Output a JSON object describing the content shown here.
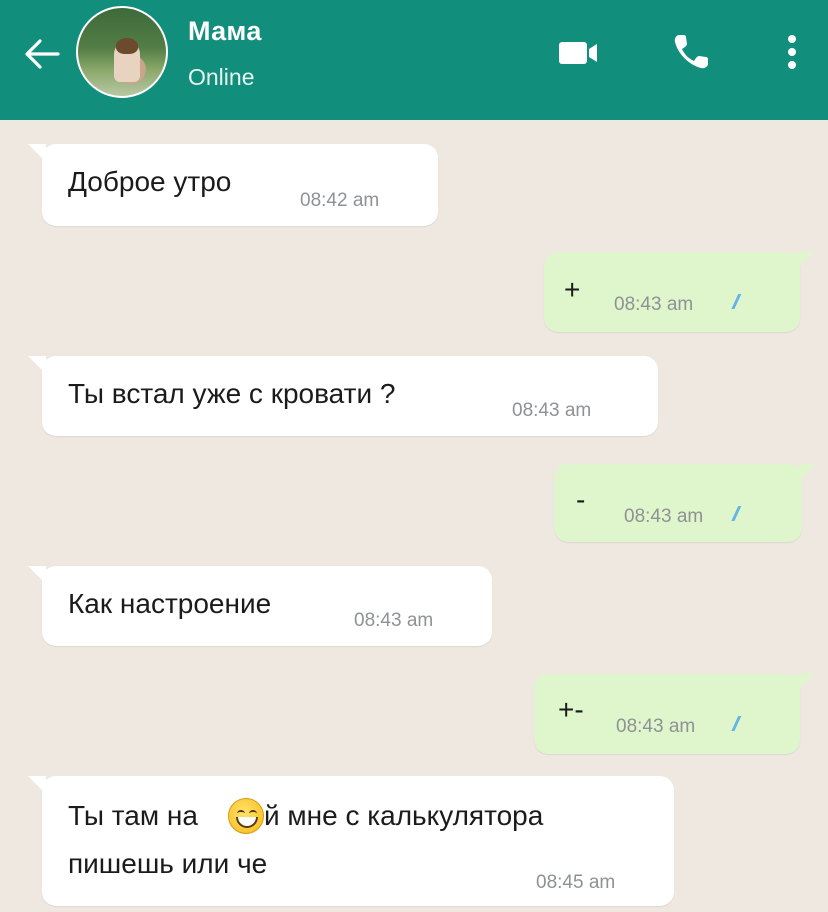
{
  "header": {
    "contact_name": "Мама",
    "status": "Online",
    "icons": [
      "back-arrow-icon",
      "video-camera-icon",
      "phone-icon",
      "more-vertical-icon"
    ],
    "bg_color": "#128e7d"
  },
  "messages": [
    {
      "direction": "incoming",
      "text": "Доброе утро",
      "time": "08:42 am"
    },
    {
      "direction": "outgoing",
      "text": "+",
      "time": "08:43 am",
      "status": "read"
    },
    {
      "direction": "incoming",
      "text": "Ты встал уже с кровати ?",
      "time": "08:43 am"
    },
    {
      "direction": "outgoing",
      "text": "-",
      "time": "08:43 am",
      "status": "read"
    },
    {
      "direction": "incoming",
      "text": "Как настроение",
      "time": "08:43 am"
    },
    {
      "direction": "outgoing",
      "text": "+-",
      "time": "08:43 am",
      "status": "read"
    },
    {
      "direction": "incoming",
      "text_before_emoji": "Ты там на",
      "text_after_emoji": "й мне с калькулятора",
      "text_line2": "пишешь или че",
      "emoji": "grinning-face-emoji",
      "time": "08:45 am"
    }
  ],
  "colors": {
    "chat_bg": "#efe8e1",
    "incoming_bubble": "#ffffff",
    "outgoing_bubble": "#dff5cc",
    "read_ticks": "#5fb3e6"
  }
}
